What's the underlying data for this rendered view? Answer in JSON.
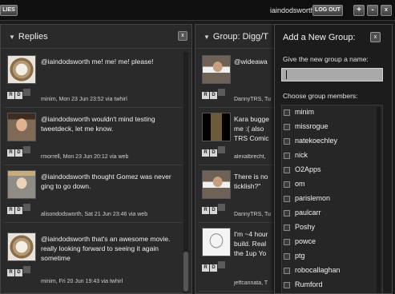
{
  "topbar": {
    "left_button": "LIES",
    "username": "iaindodsworth",
    "logout": "LOG OUT",
    "plus": "+",
    "minus": "-",
    "close": "x"
  },
  "replies_column": {
    "title": "Replies",
    "close": "x",
    "tweets": [
      {
        "lines": [
          "@iaindodsworth me! me! me! please!"
        ],
        "meta": "minim, Mon 23 Jun 23:52 via twhirl",
        "avatar": "bird-nest-avatar"
      },
      {
        "lines": [
          "@iaindodsworth wouldn't mind testing",
          "tweetdeck, let me know."
        ],
        "meta": "rmorrell, Mon 23 Jun 20:12 via web",
        "avatar": "man-portrait-avatar"
      },
      {
        "lines": [
          "@iaindodsworth thought Gomez was never",
          "ging to go down."
        ],
        "meta": "alisondodsworth, Sat 21 Jun 23:46 via web",
        "avatar": "woman-portrait-avatar"
      },
      {
        "lines": [
          "@iaindodsworth that's an awesome movie.",
          "really looking forward to seeing it again",
          "sometime"
        ],
        "meta": "minim, Fri 20 Jun 19:43 via twhirl",
        "avatar": "bird-nest-avatar"
      }
    ],
    "action_labels": [
      "R",
      "D",
      ""
    ]
  },
  "group_column": {
    "title": "Group: Digg/T",
    "tweets": [
      {
        "lines": [
          "@wideawa"
        ],
        "meta": "DannyTRS, Tu",
        "avatar": "man-with-mug-avatar"
      },
      {
        "lines": [
          "Kara bugge",
          "me :( also",
          "TRS Comic"
        ],
        "meta": "alexalbrecht,",
        "avatar": "stage-avatar"
      },
      {
        "lines": [
          "There is no",
          "ticklish?\""
        ],
        "meta": "DannyTRS, Tu",
        "avatar": "man-with-mug-avatar"
      },
      {
        "lines": [
          "I'm ~4 hour",
          "build. Real",
          "the 1up Yo"
        ],
        "meta": "jeffcannata, T",
        "avatar": "sketch-avatar"
      }
    ]
  },
  "add_group_panel": {
    "title": "Add a New Group:",
    "close": "x",
    "name_label": "Give the new group a name:",
    "name_value": "",
    "members_label": "Choose group members:",
    "members": [
      "minim",
      "missrogue",
      "natekoechley",
      "nick",
      "O2Apps",
      "om",
      "parislemon",
      "paulcarr",
      "Poshy",
      "powce",
      "ptg",
      "robocallaghan",
      "Rumford"
    ]
  }
}
